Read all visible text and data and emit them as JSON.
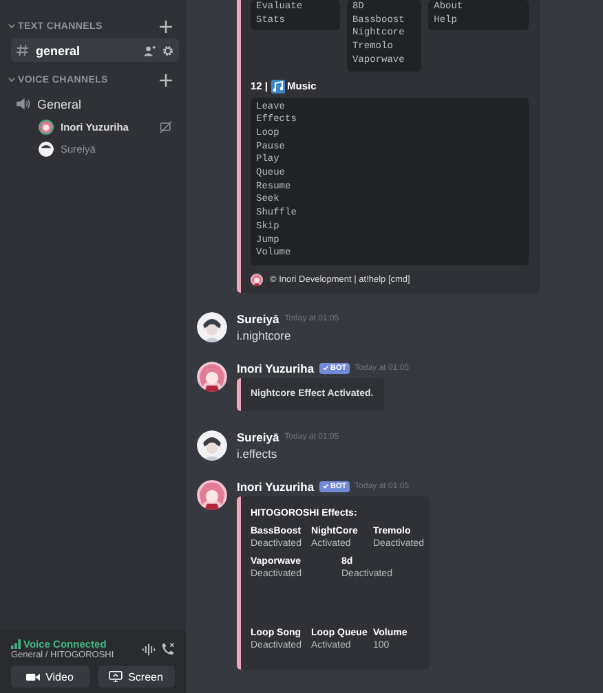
{
  "sidebar": {
    "categories": [
      {
        "name": "TEXT CHANNELS",
        "kind": "text",
        "channels": [
          {
            "name": "general",
            "selected": true
          }
        ]
      },
      {
        "name": "VOICE CHANNELS",
        "kind": "voice",
        "channels": [
          {
            "name": "General",
            "selected": false,
            "members": [
              {
                "name": "Inori Yuzuriha",
                "speaking": true
              },
              {
                "name": "Sureiyā",
                "speaking": false
              }
            ]
          }
        ]
      }
    ]
  },
  "voice_panel": {
    "status": "Voice Connected",
    "location": "General / HITOGOROSHI",
    "buttons": [
      "Video",
      "Screen"
    ]
  },
  "messages": [
    {
      "kind": "continuation",
      "embed": {
        "code_blocks": [
          [
            "Evaluate",
            "Stats"
          ],
          [
            "8D",
            "Bassboost",
            "Nightcore",
            "Tremolo",
            "Vaporwave"
          ],
          [
            "About",
            "Help"
          ]
        ],
        "section_prefix": "12 |",
        "section_title": "Music",
        "section_lines": [
          "Leave",
          "Effects",
          "Loop",
          "Pause",
          "Play",
          "Queue",
          "Resume",
          "Seek",
          "Shuffle",
          "Skip",
          "Jump",
          "Volume"
        ],
        "footer": "© Inori Development | at!help [cmd]"
      }
    },
    {
      "kind": "message",
      "author": "Sureiyā",
      "bot": false,
      "time": "Today at 01:05",
      "text": "i.nightcore"
    },
    {
      "kind": "message",
      "author": "Inori Yuzuriha",
      "bot": true,
      "bot_label": "BOT",
      "time": "Today at 01:05",
      "embed": {
        "description": "Nightcore Effect Activated."
      }
    },
    {
      "kind": "message",
      "author": "Sureiyā",
      "bot": false,
      "time": "Today at 01:05",
      "text": "i.effects"
    },
    {
      "kind": "message",
      "author": "Inori Yuzuriha",
      "bot": true,
      "bot_label": "BOT",
      "time": "Today at 01:05",
      "embed": {
        "title": "HITOGOROSHI Effects:",
        "field_rows": [
          [
            {
              "name": "BassBoost",
              "value": "Deactivated"
            },
            {
              "name": "NightCore",
              "value": "Activated"
            },
            {
              "name": "Tremolo",
              "value": "Deactivated"
            }
          ],
          [
            {
              "name": "Vaporwave",
              "value": "Deactivated"
            },
            {
              "name": "8d",
              "value": "Deactivated"
            }
          ],
          [
            {
              "name": "Loop Song",
              "value": "Deactivated"
            },
            {
              "name": "Loop Queue",
              "value": "Activated"
            },
            {
              "name": "Volume",
              "value": "100"
            }
          ]
        ]
      }
    }
  ]
}
